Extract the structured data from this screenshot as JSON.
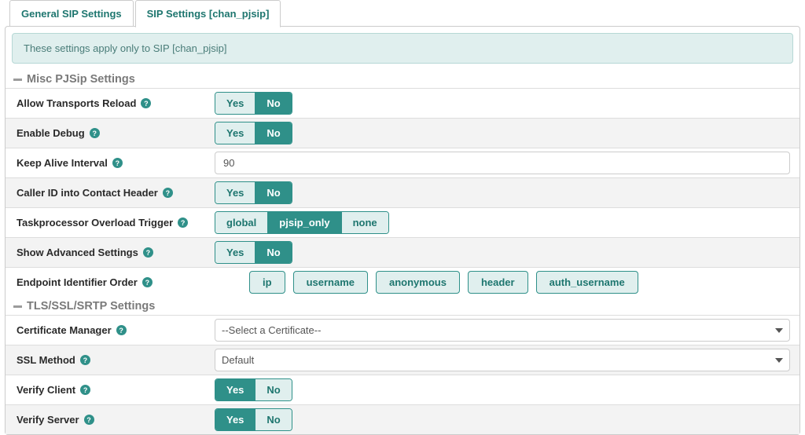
{
  "tabs": {
    "general": "General SIP Settings",
    "pjsip": "SIP Settings [chan_pjsip]"
  },
  "info_text": "These settings apply only to SIP [chan_pjsip]",
  "sections": {
    "misc": "Misc PJSip Settings",
    "tls": "TLS/SSL/SRTP Settings"
  },
  "labels": {
    "allow_transports": "Allow Transports Reload",
    "enable_debug": "Enable Debug",
    "keep_alive": "Keep Alive Interval",
    "caller_id": "Caller ID into Contact Header",
    "task_trigger": "Taskprocessor Overload Trigger",
    "show_advanced": "Show Advanced Settings",
    "endpoint_order": "Endpoint Identifier Order",
    "cert_manager": "Certificate Manager",
    "ssl_method": "SSL Method",
    "verify_client": "Verify Client",
    "verify_server": "Verify Server"
  },
  "opts": {
    "yes": "Yes",
    "no": "No",
    "global": "global",
    "pjsip_only": "pjsip_only",
    "none": "none",
    "ip": "ip",
    "username": "username",
    "anonymous": "anonymous",
    "header": "header",
    "auth_username": "auth_username"
  },
  "values": {
    "keep_alive": "90",
    "cert_manager": "--Select a Certificate--",
    "ssl_method": "Default"
  },
  "help_glyph": "?"
}
